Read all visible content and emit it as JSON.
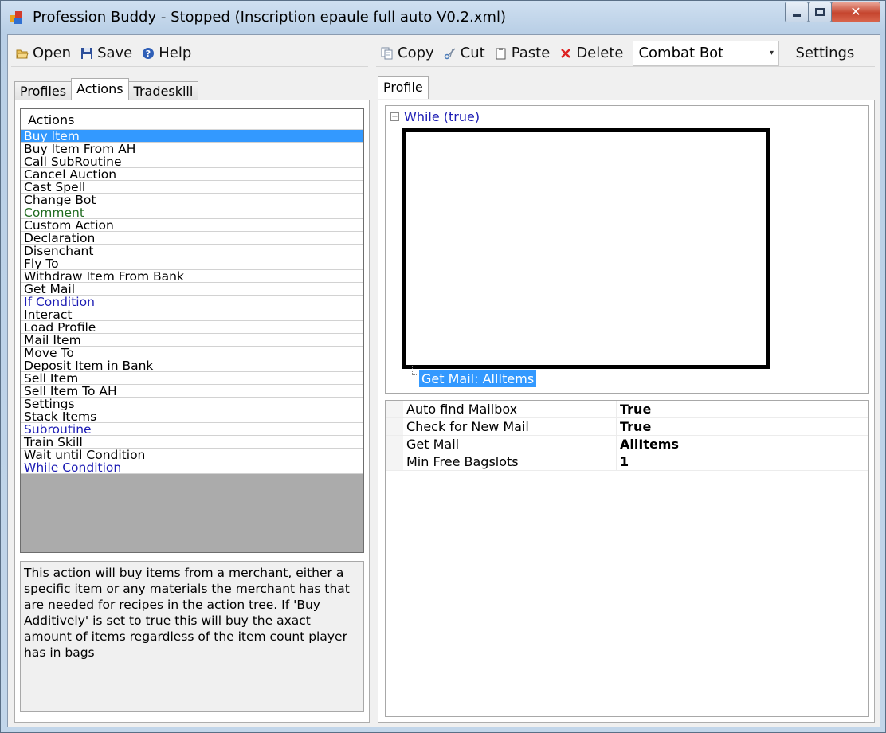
{
  "window": {
    "title": "Profession Buddy - Stopped (Inscription epaule full auto V0.2.xml)",
    "close_glyph": "✕"
  },
  "toolbar_left": {
    "open_label": "Open",
    "save_label": "Save",
    "help_label": "Help"
  },
  "toolbar_right": {
    "copy_label": "Copy",
    "cut_label": "Cut",
    "paste_label": "Paste",
    "delete_label": "Delete",
    "bot_select": "Combat Bot",
    "settings_label": "Settings"
  },
  "left_tabs": [
    "Profiles",
    "Actions",
    "Tradeskill"
  ],
  "actions_list": {
    "header": "Actions",
    "items": [
      {
        "label": "Buy Item",
        "style": "selected"
      },
      {
        "label": "Buy Item From AH",
        "style": "normal"
      },
      {
        "label": "Call SubRoutine",
        "style": "normal"
      },
      {
        "label": "Cancel Auction",
        "style": "normal"
      },
      {
        "label": "Cast Spell",
        "style": "normal"
      },
      {
        "label": "Change Bot",
        "style": "normal"
      },
      {
        "label": "Comment",
        "style": "green"
      },
      {
        "label": "Custom Action",
        "style": "normal"
      },
      {
        "label": "Declaration",
        "style": "normal"
      },
      {
        "label": "Disenchant",
        "style": "normal"
      },
      {
        "label": "Fly To",
        "style": "normal"
      },
      {
        "label": "Withdraw Item From Bank",
        "style": "normal"
      },
      {
        "label": "Get Mail",
        "style": "normal"
      },
      {
        "label": "If Condition",
        "style": "blue"
      },
      {
        "label": "Interact",
        "style": "normal"
      },
      {
        "label": "Load Profile",
        "style": "normal"
      },
      {
        "label": "Mail Item",
        "style": "normal"
      },
      {
        "label": "Move To",
        "style": "normal"
      },
      {
        "label": "Deposit Item in Bank",
        "style": "normal"
      },
      {
        "label": "Sell Item",
        "style": "normal"
      },
      {
        "label": "Sell Item To AH",
        "style": "normal"
      },
      {
        "label": "Settings",
        "style": "normal"
      },
      {
        "label": "Stack Items",
        "style": "normal"
      },
      {
        "label": "Subroutine",
        "style": "blue"
      },
      {
        "label": "Train Skill",
        "style": "normal"
      },
      {
        "label": "Wait until Condition",
        "style": "normal"
      },
      {
        "label": "While Condition",
        "style": "blue"
      }
    ]
  },
  "description": "This action will buy items from a merchant, either a specific item or any materials the merchant has that are needed for recipes in the action tree. If 'Buy Additively' is set to true this will buy the axact amount of items regardless of the item count player has in bags",
  "right_tabs": [
    "Profile"
  ],
  "tree": {
    "expander_glyph": "−",
    "root_label": "While (true)",
    "child_label": "Get Mail: AllItems"
  },
  "properties": [
    {
      "name": "Auto find Mailbox",
      "value": "True"
    },
    {
      "name": "Check for New Mail",
      "value": "True"
    },
    {
      "name": "Get Mail",
      "value": "AllItems"
    },
    {
      "name": "Min Free Bagslots",
      "value": "1"
    }
  ],
  "icons": {
    "app": "app-icon",
    "open": "folder-open-icon",
    "save": "floppy-disk-icon",
    "help": "help-icon",
    "copy": "copy-icon",
    "cut": "scissors-icon",
    "paste": "clipboard-icon",
    "delete": "red-x-icon"
  },
  "colors": {
    "selection": "#3399ff",
    "comment_green": "#1f6b1f",
    "keyword_blue": "#1c1cb4"
  }
}
